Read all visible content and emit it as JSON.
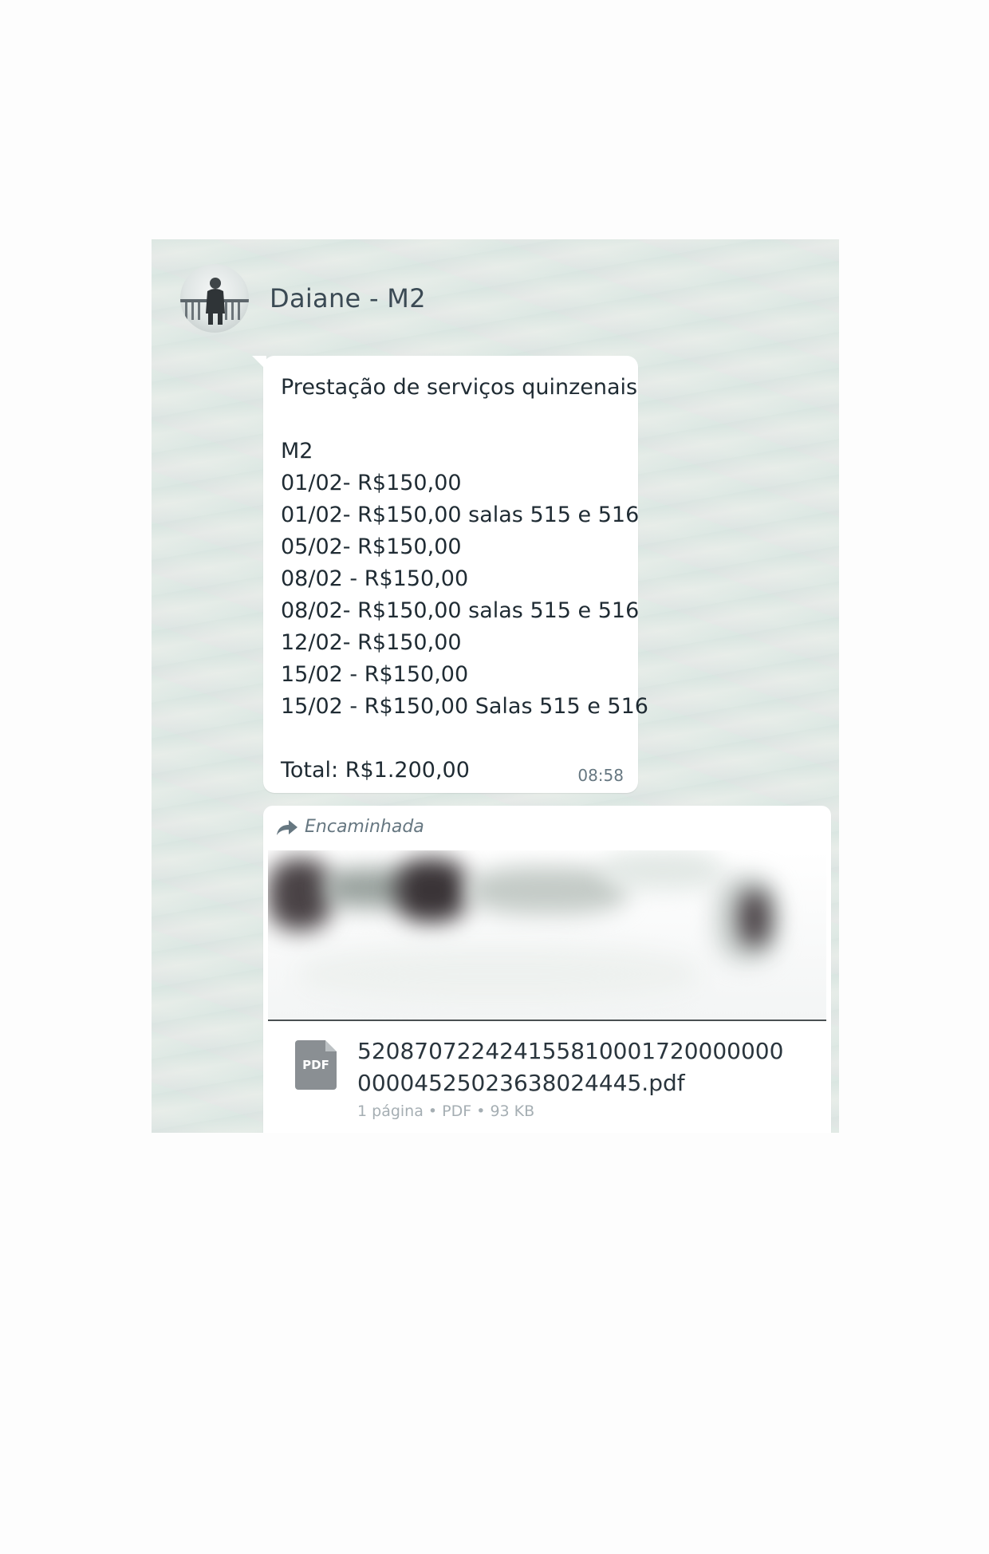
{
  "chat": {
    "contact_name": "Daiane - M2",
    "avatar_icon": "person-at-railing-avatar"
  },
  "message": {
    "lines": [
      "Prestação de serviços quinzenais",
      "",
      "M2",
      "01/02- R$150,00",
      "01/02- R$150,00 salas 515 e 516",
      "05/02- R$150,00",
      "08/02 - R$150,00",
      "08/02- R$150,00 salas 515 e 516",
      "12/02- R$150,00",
      "15/02 - R$150,00",
      "15/02 - R$150,00 Salas 515 e 516",
      "",
      "Total: R$1.200,00"
    ],
    "time": "08:58"
  },
  "forwarded": {
    "label": "Encaminhada",
    "icon": "forward-arrow-icon",
    "document": {
      "icon_text": "PDF",
      "filename": "52087072242415581000172000000000004525023638024445.pdf",
      "meta": "1 página • PDF • 93 KB"
    }
  }
}
